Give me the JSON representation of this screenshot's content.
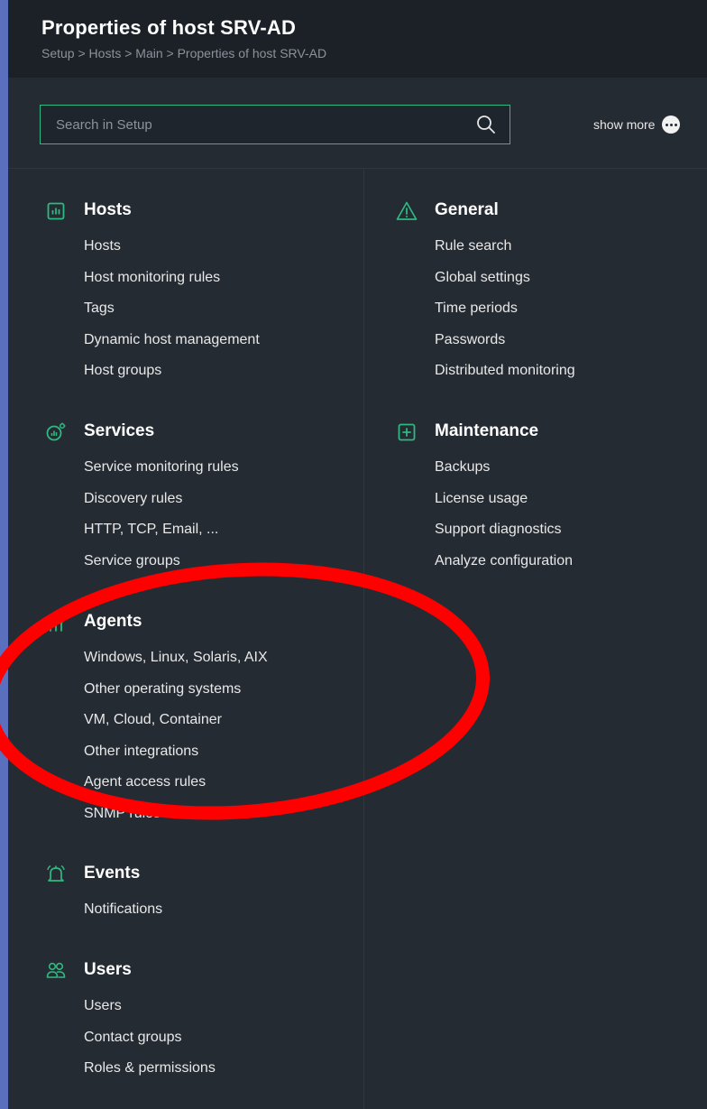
{
  "header": {
    "title": "Properties of host SRV-AD",
    "breadcrumb": "Setup > Hosts > Main > Properties of host SRV-AD"
  },
  "search": {
    "placeholder": "Search in Setup",
    "value": "",
    "icon": "search-icon"
  },
  "show_more": {
    "label": "show more",
    "icon": "more-dots-icon"
  },
  "colors": {
    "accent": "#2fb980",
    "panel_bg": "#252b33",
    "header_bg": "#1c2128",
    "annotation": "#ff0000",
    "backdrop": "#5b6fbf"
  },
  "sections_left": [
    {
      "title": "Hosts",
      "icon": "hosts-icon",
      "items": [
        "Hosts",
        "Host monitoring rules",
        "Tags",
        "Dynamic host management",
        "Host groups"
      ]
    },
    {
      "title": "Services",
      "icon": "services-icon",
      "items": [
        "Service monitoring rules",
        "Discovery rules",
        "HTTP, TCP, Email, ...",
        "Service groups"
      ]
    },
    {
      "title": "Agents",
      "icon": "agents-icon",
      "items": [
        "Windows, Linux, Solaris, AIX",
        "Other operating systems",
        "VM, Cloud, Container",
        "Other integrations",
        "Agent access rules",
        "SNMP rules"
      ]
    },
    {
      "title": "Events",
      "icon": "bell-icon",
      "items": [
        "Notifications"
      ]
    },
    {
      "title": "Users",
      "icon": "users-icon",
      "items": [
        "Users",
        "Contact groups",
        "Roles & permissions"
      ]
    }
  ],
  "sections_right": [
    {
      "title": "General",
      "icon": "warning-triangle-icon",
      "items": [
        "Rule search",
        "Global settings",
        "Time periods",
        "Passwords",
        "Distributed monitoring"
      ]
    },
    {
      "title": "Maintenance",
      "icon": "maintenance-plus-icon",
      "items": [
        "Backups",
        "License usage",
        "Support diagnostics",
        "Analyze configuration"
      ]
    }
  ]
}
